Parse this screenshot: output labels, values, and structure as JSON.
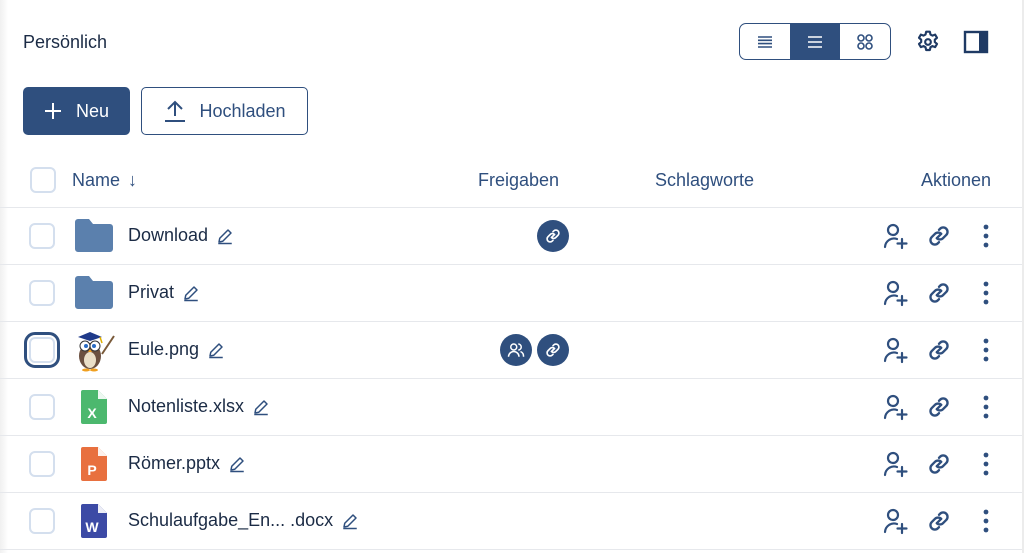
{
  "header": {
    "title": "Persönlich",
    "view_modes": [
      {
        "name": "compact-list",
        "active": false
      },
      {
        "name": "list",
        "active": true
      },
      {
        "name": "grid",
        "active": false
      }
    ],
    "settings_icon": "gear-icon",
    "sidebar_toggle_icon": "sidebar-panel-icon"
  },
  "toolbar": {
    "new_label": "Neu",
    "upload_label": "Hochladen"
  },
  "table": {
    "columns": {
      "name": "Name",
      "sort_indicator": "↓",
      "shares": "Freigaben",
      "tags": "Schlagworte",
      "actions": "Aktionen"
    },
    "rows": [
      {
        "name": "Download",
        "type": "folder",
        "shares": [
          "link"
        ],
        "focused": false
      },
      {
        "name": "Privat",
        "type": "folder",
        "shares": [],
        "focused": false
      },
      {
        "name": "Eule.png",
        "type": "image",
        "shares": [
          "users",
          "link"
        ],
        "focused": true
      },
      {
        "name": "Notenliste.xlsx",
        "type": "xlsx",
        "icon_letter": "X",
        "shares": [],
        "focused": false
      },
      {
        "name": "Römer.pptx",
        "type": "pptx",
        "icon_letter": "P",
        "shares": [],
        "focused": false
      },
      {
        "name": "Schulaufgabe_En...  .docx",
        "type": "docx",
        "icon_letter": "W",
        "shares": [],
        "focused": false
      }
    ]
  },
  "colors": {
    "primary": "#2f4f7e",
    "folder": "#5b80ad",
    "xlsx": "#4cb86e",
    "pptx": "#e8703f",
    "docx": "#3c4aa5"
  }
}
